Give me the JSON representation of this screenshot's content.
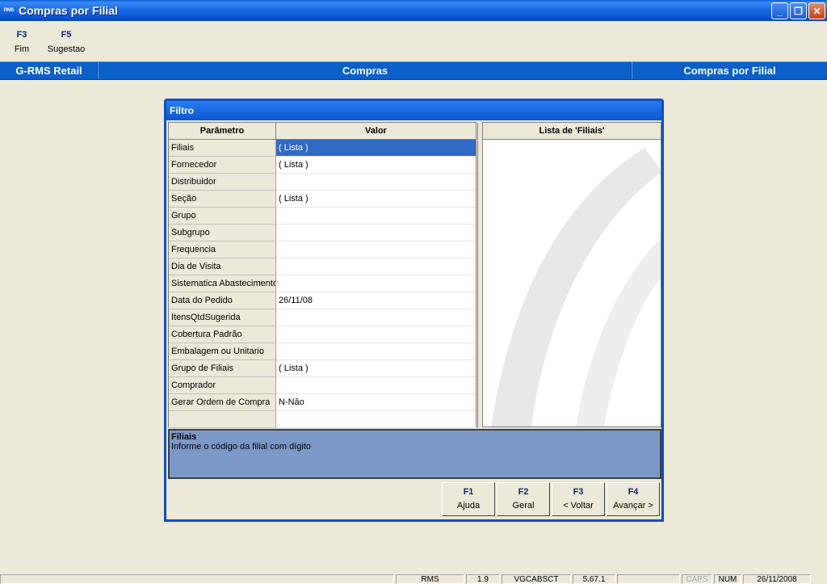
{
  "window": {
    "icon_text": "RMS",
    "title": "Compras por Filial",
    "minimize": "_",
    "restore": "❐",
    "close": "✕"
  },
  "fkeys": [
    {
      "key": "F3",
      "label": "Fim"
    },
    {
      "key": "F5",
      "label": "Sugestao"
    }
  ],
  "header": {
    "left": "G-RMS Retail",
    "center": "Compras",
    "right": "Compras por Filial"
  },
  "dialog": {
    "title": "Filtro",
    "columns": {
      "param": "Parâmetro",
      "value": "Valor"
    },
    "rows": [
      {
        "param": "Filiais",
        "value": "( Lista )"
      },
      {
        "param": "Fornecedor",
        "value": "( Lista )"
      },
      {
        "param": "Distribuidor",
        "value": ""
      },
      {
        "param": "Seção",
        "value": "( Lista )"
      },
      {
        "param": "Grupo",
        "value": ""
      },
      {
        "param": "Subgrupo",
        "value": ""
      },
      {
        "param": "Frequencia",
        "value": ""
      },
      {
        "param": "Dia de Visita",
        "value": ""
      },
      {
        "param": "Sistematica Abastecimento",
        "value": ""
      },
      {
        "param": "Data do Pedido",
        "value": "26/11/08"
      },
      {
        "param": "ItensQtdSugerida",
        "value": ""
      },
      {
        "param": "Cobertura Padrão",
        "value": ""
      },
      {
        "param": "Embalagem ou Unitario",
        "value": ""
      },
      {
        "param": "Grupo de Filiais",
        "value": "( Lista )"
      },
      {
        "param": "Comprador",
        "value": ""
      },
      {
        "param": "Gerar Ordem de Compra",
        "value": "N-Não"
      },
      {
        "param": "",
        "value": ""
      }
    ],
    "list_title": "Lista de 'Filiais'",
    "hint": {
      "title": "Filiais",
      "text": "Informe o código da filial com dígito"
    },
    "buttons": [
      {
        "key": "F1",
        "label": "Ajuda"
      },
      {
        "key": "F2",
        "label": "Geral"
      },
      {
        "key": "F3",
        "label": "< Voltar"
      },
      {
        "key": "F4",
        "label": "Avançar >"
      }
    ]
  },
  "statusbar": {
    "app": "RMS",
    "version": "1.9",
    "user": "VGCABSCT",
    "build": "5.67.1",
    "empty": "",
    "caps": "CAPS",
    "num": "NUM",
    "date": "26/11/2008"
  }
}
